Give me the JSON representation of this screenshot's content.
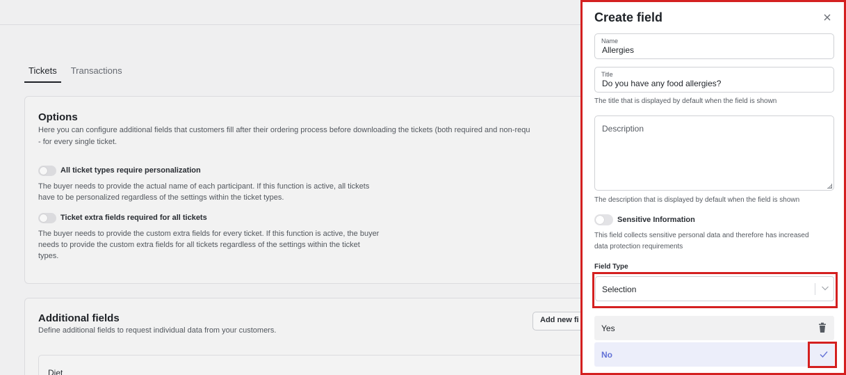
{
  "background": {
    "tabs": [
      "Tickets",
      "Transactions"
    ],
    "options": {
      "title": "Options",
      "description_line1": "Here you can configure additional fields that customers fill after their ordering process before downloading the tickets (both required and non-requ",
      "description_line2": "- for every single ticket.",
      "personalization_label": "All ticket types require personalization",
      "personalization_desc_1": "The buyer needs to provide the actual name of each participant. If this function is active, all tickets",
      "personalization_desc_2": "have to be personalized regardless of the settings within the ticket types.",
      "extra_fields_label": "Ticket extra fields required for all tickets",
      "extra_fields_desc_1": "The buyer needs to provide the custom extra fields for every ticket. If this function is active, the buyer",
      "extra_fields_desc_2": "needs to provide the custom extra fields for all tickets regardless of the settings within the ticket",
      "extra_fields_desc_3": "types."
    },
    "additional_fields": {
      "title": "Additional fields",
      "description": "Define additional fields to request individual data from your customers.",
      "add_button": "Add new fi",
      "first_row": "Diet"
    }
  },
  "drawer": {
    "title": "Create field",
    "close_icon": "close-icon",
    "name": {
      "label": "Name",
      "value": "Allergies"
    },
    "title_field": {
      "label": "Title",
      "value": "Do you have any food allergies?"
    },
    "title_hint": "The title that is displayed by default when the field is shown",
    "description": {
      "placeholder": "Description"
    },
    "description_hint": "The description that is displayed by default when the field is shown",
    "sensitive": {
      "label": "Sensitive Information",
      "enabled": false,
      "hint_1": "This field collects sensitive personal data and therefore has increased",
      "hint_2": "data protection requirements"
    },
    "field_type": {
      "label": "Field Type",
      "value": "Selection"
    },
    "options": [
      {
        "label": "Yes",
        "action_icon": "trash-icon"
      },
      {
        "label": "No",
        "action_icon": "check-icon",
        "editing": true
      }
    ]
  },
  "colors": {
    "highlight": "#d42020",
    "accent": "#6271d6",
    "editing_row_bg": "#eceefa"
  }
}
